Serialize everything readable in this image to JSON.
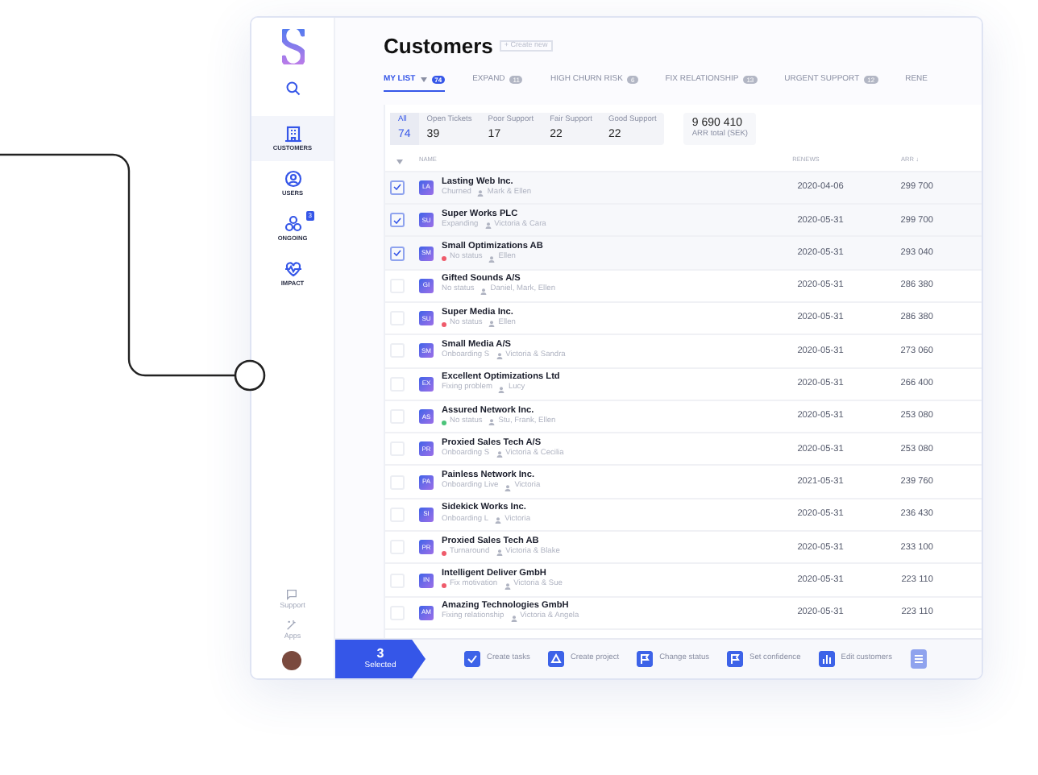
{
  "sidebar": {
    "items": [
      {
        "label": "CUSTOMERS",
        "kind": "customers",
        "selected": true
      },
      {
        "label": "USERS",
        "kind": "users",
        "selected": false
      },
      {
        "label": "ONGOING",
        "kind": "ongoing",
        "selected": false,
        "badge": "3"
      },
      {
        "label": "IMPACT",
        "kind": "impact",
        "selected": false
      }
    ],
    "footer": [
      {
        "label": "Support",
        "kind": "support"
      },
      {
        "label": "Apps",
        "kind": "apps"
      }
    ]
  },
  "header": {
    "title": "Customers",
    "create_button": "+ Create new"
  },
  "tabs": [
    {
      "label": "MY LIST",
      "count": "74",
      "selected": true,
      "dropdown": true
    },
    {
      "label": "EXPAND",
      "count": "11",
      "selected": false,
      "dropdown": false
    },
    {
      "label": "HIGH CHURN RISK",
      "count": "6",
      "selected": false,
      "dropdown": false
    },
    {
      "label": "FIX RELATIONSHIP",
      "count": "13",
      "selected": false,
      "dropdown": false
    },
    {
      "label": "URGENT SUPPORT",
      "count": "12",
      "selected": false,
      "dropdown": false
    },
    {
      "label": "RENE",
      "selected": false,
      "dropdown": false
    }
  ],
  "filters": [
    {
      "label": "All",
      "value": "74",
      "selected": true
    },
    {
      "label": "Open Tickets",
      "value": "39",
      "selected": false
    },
    {
      "label": "Poor Support",
      "value": "17",
      "selected": false
    },
    {
      "label": "Fair Support",
      "value": "22",
      "selected": false
    },
    {
      "label": "Good Support",
      "value": "22",
      "selected": false
    }
  ],
  "arr_total": {
    "value": "9 690 410",
    "label": "ARR total (SEK)"
  },
  "table": {
    "columns": [
      "NAME",
      "RENEWS",
      "ARR ↓"
    ],
    "rows": [
      {
        "initials": "LA",
        "name": "Lasting Web Inc.",
        "status": "Churned",
        "owners": "Mark & Ellen",
        "renews": "2020-04-06",
        "arr": "299 700",
        "checked": true
      },
      {
        "initials": "SU",
        "name": "Super Works PLC",
        "status": "Expanding",
        "owners": "Victoria & Cara",
        "renews": "2020-05-31",
        "arr": "299 700",
        "checked": true
      },
      {
        "initials": "SM",
        "name": "Small Optimizations AB",
        "status": "No status",
        "color": "#ef5b6b",
        "owners": "Ellen",
        "renews": "2020-05-31",
        "arr": "293 040",
        "checked": true
      },
      {
        "initials": "GI",
        "name": "Gifted Sounds A/S",
        "status": "No status",
        "owners": "Daniel, Mark, Ellen",
        "renews": "2020-05-31",
        "arr": "286 380",
        "checked": false
      },
      {
        "initials": "SU",
        "name": "Super Media Inc.",
        "status": "No status",
        "color": "#ef5b6b",
        "owners": "Ellen",
        "renews": "2020-05-31",
        "arr": "286 380",
        "checked": false
      },
      {
        "initials": "SM",
        "name": "Small Media A/S",
        "status": "Onboarding S",
        "owners": "Victoria & Sandra",
        "renews": "2020-05-31",
        "arr": "273 060",
        "checked": false
      },
      {
        "initials": "EX",
        "name": "Excellent Optimizations Ltd",
        "status": "Fixing problem",
        "owners": "Lucy",
        "renews": "2020-05-31",
        "arr": "266 400",
        "checked": false
      },
      {
        "initials": "AS",
        "name": "Assured Network Inc.",
        "status": "No status",
        "color": "#4cc47a",
        "owners": "Stu, Frank, Ellen",
        "renews": "2020-05-31",
        "arr": "253 080",
        "checked": false
      },
      {
        "initials": "PR",
        "name": "Proxied Sales Tech A/S",
        "status": "Onboarding S",
        "owners": "Victoria & Cecilia",
        "renews": "2020-05-31",
        "arr": "253 080",
        "checked": false
      },
      {
        "initials": "PA",
        "name": "Painless Network Inc.",
        "status": "Onboarding Live",
        "owners": "Victoria",
        "renews": "2021-05-31",
        "arr": "239 760",
        "checked": false
      },
      {
        "initials": "SI",
        "name": "Sidekick Works Inc.",
        "status": "Onboarding L",
        "owners": "Victoria",
        "renews": "2020-05-31",
        "arr": "236 430",
        "checked": false
      },
      {
        "initials": "PR",
        "name": "Proxied Sales Tech AB",
        "status": "Turnaround",
        "color": "#ef5b6b",
        "owners": "Victoria & Blake",
        "renews": "2020-05-31",
        "arr": "233 100",
        "checked": false
      },
      {
        "initials": "IN",
        "name": "Intelligent Deliver GmbH",
        "status": "Fix motivation",
        "color": "#ef5b6b",
        "owners": "Victoria & Sue",
        "renews": "2020-05-31",
        "arr": "223 110",
        "checked": false
      },
      {
        "initials": "AM",
        "name": "Amazing Technologies GmbH",
        "status": "Fixing relationship",
        "owners": "Victoria & Angela",
        "renews": "2020-05-31",
        "arr": "223 110",
        "checked": false
      }
    ]
  },
  "selection_bar": {
    "count": "3",
    "label": "Selected",
    "actions": [
      {
        "label": "Create tasks",
        "kind": "check"
      },
      {
        "label": "Create project",
        "kind": "project"
      },
      {
        "label": "Change status",
        "kind": "flag"
      },
      {
        "label": "Set confidence",
        "kind": "flag"
      },
      {
        "label": "Edit customers",
        "kind": "edit"
      },
      {
        "kind": "more"
      }
    ]
  }
}
